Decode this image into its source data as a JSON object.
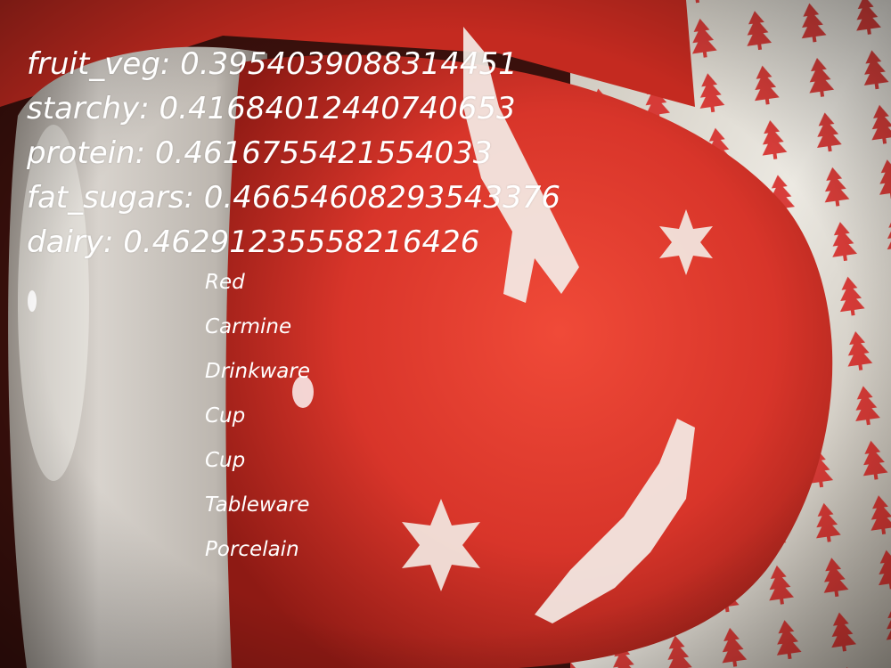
{
  "scores": [
    {
      "key": "fruit_veg",
      "value": "0.3954039088314451"
    },
    {
      "key": "starchy",
      "value": "0.41684012440740653"
    },
    {
      "key": "protein",
      "value": "0.4616755421554033"
    },
    {
      "key": "fat_sugars",
      "value": "0.46654608293543376"
    },
    {
      "key": "dairy",
      "value": "0.46291235558216426"
    }
  ],
  "labels": [
    "Red",
    "Carmine",
    "Drinkware",
    "Cup",
    "Cup",
    "Tableware",
    "Porcelain"
  ],
  "colors": {
    "cup_red": "#d8352a",
    "cup_red_dark": "#8e1a14",
    "cup_interior": "#cfcac4",
    "napkin": "#ece9e2",
    "tree_red": "#d5201d",
    "text": "#ffffff"
  },
  "icons": [
    "reindeer-motif",
    "snowflake-motif",
    "christmas-tree-pattern"
  ]
}
